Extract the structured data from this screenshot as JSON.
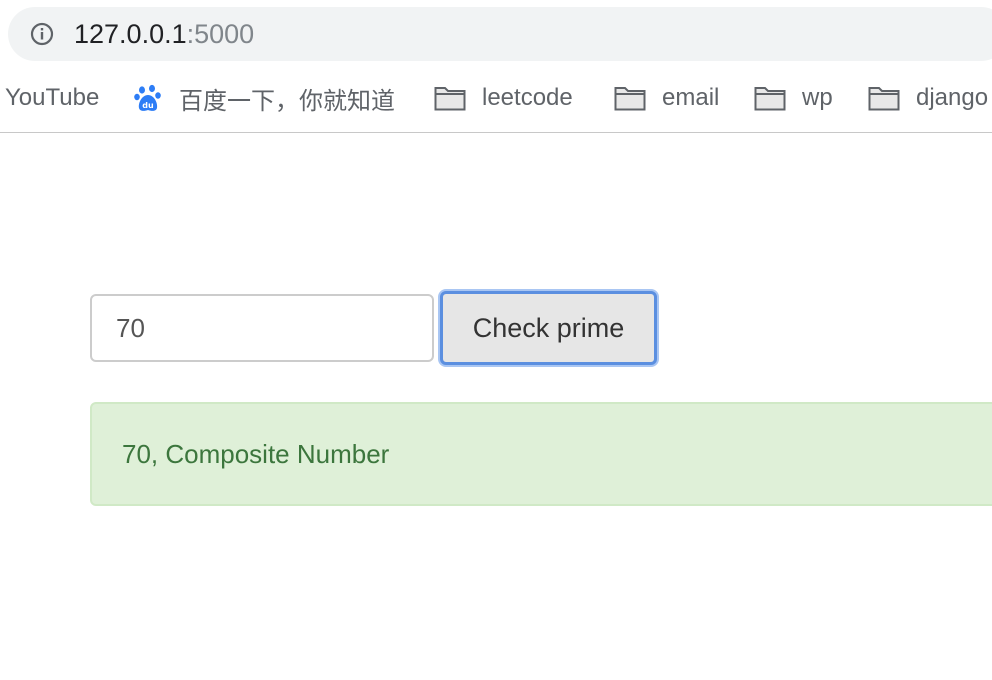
{
  "browser": {
    "url_host": "127.0.0.1",
    "url_port": ":5000",
    "bookmarks": [
      {
        "label": "YouTube",
        "icon": "none"
      },
      {
        "label": "百度一下，你就知道",
        "icon": "baidu-paw-icon"
      },
      {
        "label": "leetcode",
        "icon": "folder-icon"
      },
      {
        "label": "email",
        "icon": "folder-icon"
      },
      {
        "label": "wp",
        "icon": "folder-icon"
      },
      {
        "label": "django",
        "icon": "folder-icon"
      }
    ]
  },
  "form": {
    "input_value": "70",
    "button_label": "Check prime"
  },
  "result": {
    "message": "70, Composite Number"
  },
  "colors": {
    "alert_background": "#dff0d8",
    "alert_text": "#3c763d",
    "button_focus_ring": "#5b8fe0",
    "baidu_blue": "#2d7df6"
  }
}
